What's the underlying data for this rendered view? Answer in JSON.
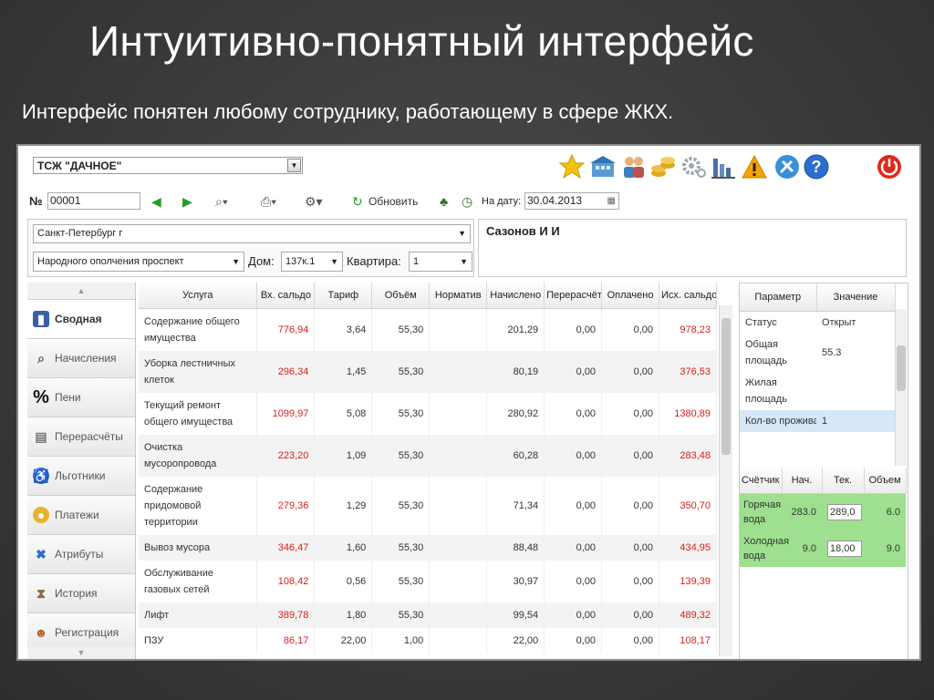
{
  "slide": {
    "title": "Интуитивно-понятный интерфейс",
    "subtitle": "Интерфейс понятен любому сотруднику, работающему в сфере ЖКХ."
  },
  "toolbar": {
    "org": "ТСЖ \"ДАЧНОЕ\"",
    "num_label": "№",
    "account": "00001",
    "refresh": "Обновить",
    "date_label": "На дату:",
    "date": "30.04.2013"
  },
  "address": {
    "city": "Санкт-Петербург г",
    "street": "Народного ополчения проспект",
    "house_label": "Дом:",
    "house": "137к.1",
    "flat_label": "Квартира:",
    "flat": "1",
    "person": "Сазонов И И"
  },
  "sidebar": {
    "items": [
      {
        "label": "Сводная",
        "icon": "book-icon"
      },
      {
        "label": "Начисления",
        "icon": "magnifier-icon"
      },
      {
        "label": "Пени",
        "icon": "percent-icon"
      },
      {
        "label": "Перерасчёты",
        "icon": "calculator-icon"
      },
      {
        "label": "Льготники",
        "icon": "wheelchair-icon"
      },
      {
        "label": "Платежи",
        "icon": "coins-icon"
      },
      {
        "label": "Атрибуты",
        "icon": "tools-icon"
      },
      {
        "label": "История",
        "icon": "hourglass-icon"
      },
      {
        "label": "Регистрация",
        "icon": "users-icon"
      }
    ]
  },
  "table": {
    "headers": [
      "Услуга",
      "Вх. сальдо",
      "Тариф",
      "Объём",
      "Норматив",
      "Начислено",
      "Перерасчёт",
      "Оплачено",
      "Исх. сальдо"
    ],
    "rows": [
      {
        "service": "Содержание общего имущества",
        "in": "776,94",
        "tariff": "3,64",
        "volume": "55,30",
        "norm": "",
        "charged": "201,29",
        "recalc": "0,00",
        "paid": "0,00",
        "out": "978,23"
      },
      {
        "service": "Уборка лестничных клеток",
        "in": "296,34",
        "tariff": "1,45",
        "volume": "55,30",
        "norm": "",
        "charged": "80,19",
        "recalc": "0,00",
        "paid": "0,00",
        "out": "376,53"
      },
      {
        "service": "Текущий ремонт общего имущества",
        "in": "1099,97",
        "tariff": "5,08",
        "volume": "55,30",
        "norm": "",
        "charged": "280,92",
        "recalc": "0,00",
        "paid": "0,00",
        "out": "1380,89"
      },
      {
        "service": "Очистка мусоропровода",
        "in": "223,20",
        "tariff": "1,09",
        "volume": "55,30",
        "norm": "",
        "charged": "60,28",
        "recalc": "0,00",
        "paid": "0,00",
        "out": "283,48"
      },
      {
        "service": "Содержание придомовой территории",
        "in": "279,36",
        "tariff": "1,29",
        "volume": "55,30",
        "norm": "",
        "charged": "71,34",
        "recalc": "0,00",
        "paid": "0,00",
        "out": "350,70"
      },
      {
        "service": "Вывоз мусора",
        "in": "346,47",
        "tariff": "1,60",
        "volume": "55,30",
        "norm": "",
        "charged": "88,48",
        "recalc": "0,00",
        "paid": "0,00",
        "out": "434,95"
      },
      {
        "service": "Обслуживание газовых сетей",
        "in": "108,42",
        "tariff": "0,56",
        "volume": "55,30",
        "norm": "",
        "charged": "30,97",
        "recalc": "0,00",
        "paid": "0,00",
        "out": "139,39"
      },
      {
        "service": "Лифт",
        "in": "389,78",
        "tariff": "1,80",
        "volume": "55,30",
        "norm": "",
        "charged": "99,54",
        "recalc": "0,00",
        "paid": "0,00",
        "out": "489,32"
      },
      {
        "service": "ПЗУ",
        "in": "86,17",
        "tariff": "22,00",
        "volume": "1,00",
        "norm": "",
        "charged": "22,00",
        "recalc": "0,00",
        "paid": "0,00",
        "out": "108,17"
      }
    ]
  },
  "params": {
    "headers": [
      "Параметр",
      "Значение"
    ],
    "rows": [
      {
        "name": "Статус",
        "value": "Открыт"
      },
      {
        "name": "Общая площадь",
        "value": "55.3"
      },
      {
        "name": "Жилая площадь",
        "value": ""
      },
      {
        "name": "Кол-во проживающих",
        "value": "1"
      }
    ]
  },
  "meters": {
    "headers": [
      "Счётчик",
      "Нач.",
      "Тек.",
      "Объем"
    ],
    "rows": [
      {
        "name": "Горячая вода",
        "start": "283.0",
        "current": "289,0",
        "volume": "6.0"
      },
      {
        "name": "Холодная вода",
        "start": "9.0",
        "current": "18,00",
        "volume": "9.0"
      }
    ]
  },
  "colors": {
    "negative_red": "#d81e1e",
    "meter_green": "#9ee08f",
    "selected_blue": "#d6e8f7"
  }
}
